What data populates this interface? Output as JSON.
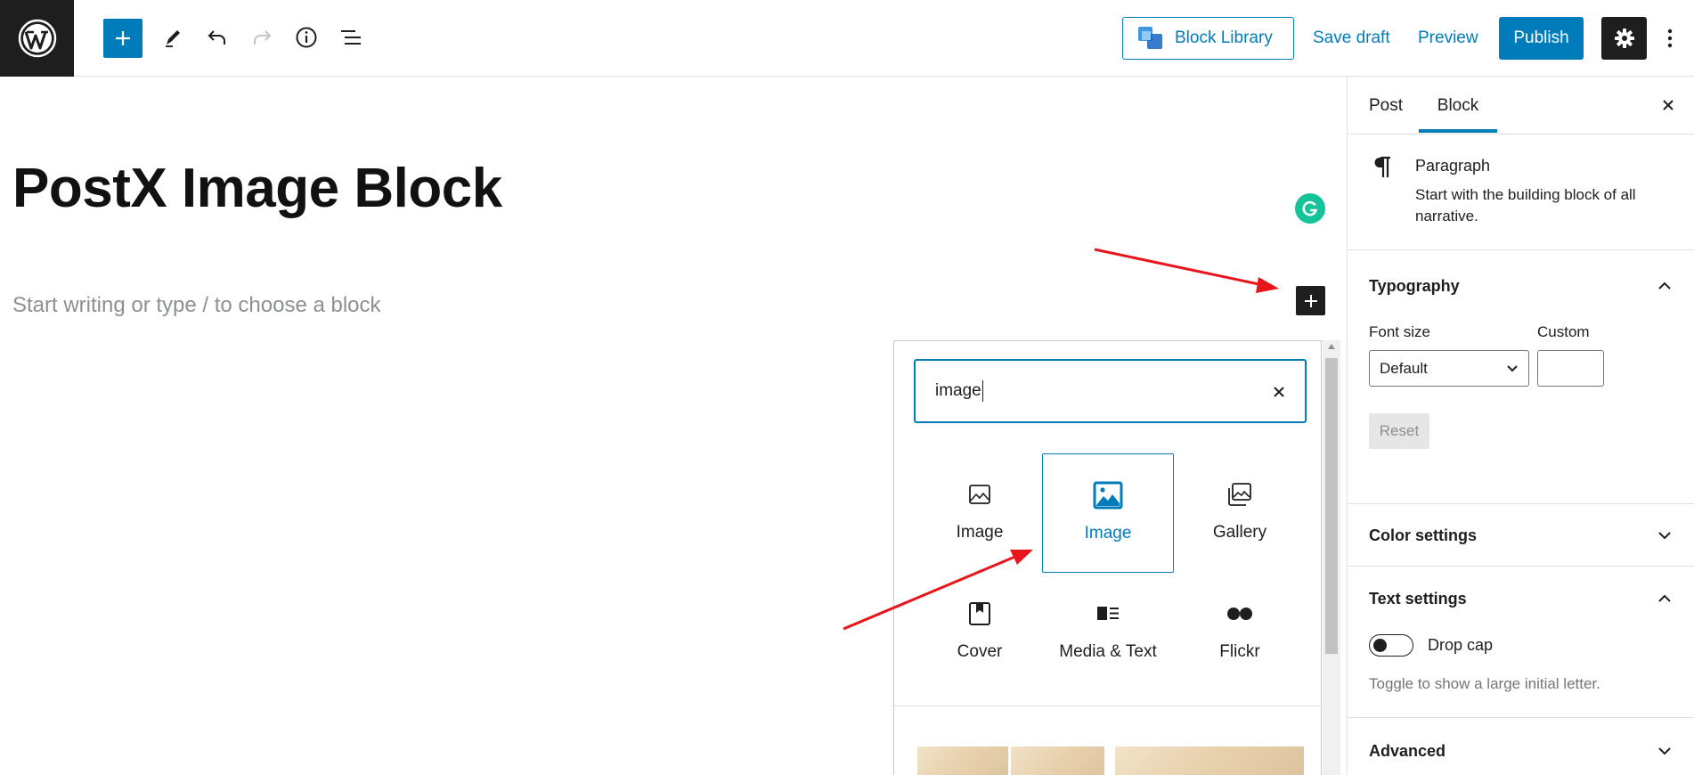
{
  "toolbar": {
    "block_library_label": "Block Library",
    "save_draft_label": "Save draft",
    "preview_label": "Preview",
    "publish_label": "Publish",
    "icons": [
      "wordpress-logo",
      "plus-icon",
      "pencil-icon",
      "undo-icon",
      "redo-icon",
      "info-icon",
      "list-view-icon",
      "gear-icon",
      "more-vertical-icon"
    ]
  },
  "editor": {
    "title": "PostX Image Block",
    "placeholder": "Start writing or type / to choose a block"
  },
  "inserter": {
    "search_value": "image",
    "blocks": [
      {
        "label": "Image",
        "icon": "image-icon",
        "selected": false
      },
      {
        "label": "Image",
        "icon": "image-icon",
        "selected": true
      },
      {
        "label": "Gallery",
        "icon": "gallery-icon",
        "selected": false
      },
      {
        "label": "Cover",
        "icon": "cover-icon",
        "selected": false
      },
      {
        "label": "Media & Text",
        "icon": "media-text-icon",
        "selected": false
      },
      {
        "label": "Flickr",
        "icon": "flickr-icon",
        "selected": false
      }
    ]
  },
  "sidebar": {
    "tabs": [
      {
        "label": "Post",
        "active": false
      },
      {
        "label": "Block",
        "active": true
      }
    ],
    "block_card": {
      "title": "Paragraph",
      "description": "Start with the building block of all narrative."
    },
    "typography": {
      "title": "Typography",
      "font_size_label": "Font size",
      "custom_label": "Custom",
      "font_size_value": "Default",
      "reset_label": "Reset"
    },
    "color_settings": {
      "title": "Color settings"
    },
    "text_settings": {
      "title": "Text settings",
      "drop_cap_label": "Drop cap",
      "drop_cap_help": "Toggle to show a large initial letter."
    },
    "advanced": {
      "title": "Advanced"
    }
  },
  "colors": {
    "accent": "#007cba",
    "dark": "#1e1e1e",
    "annotation_arrow": "#e8151b",
    "grammarly": "#15c39a"
  }
}
